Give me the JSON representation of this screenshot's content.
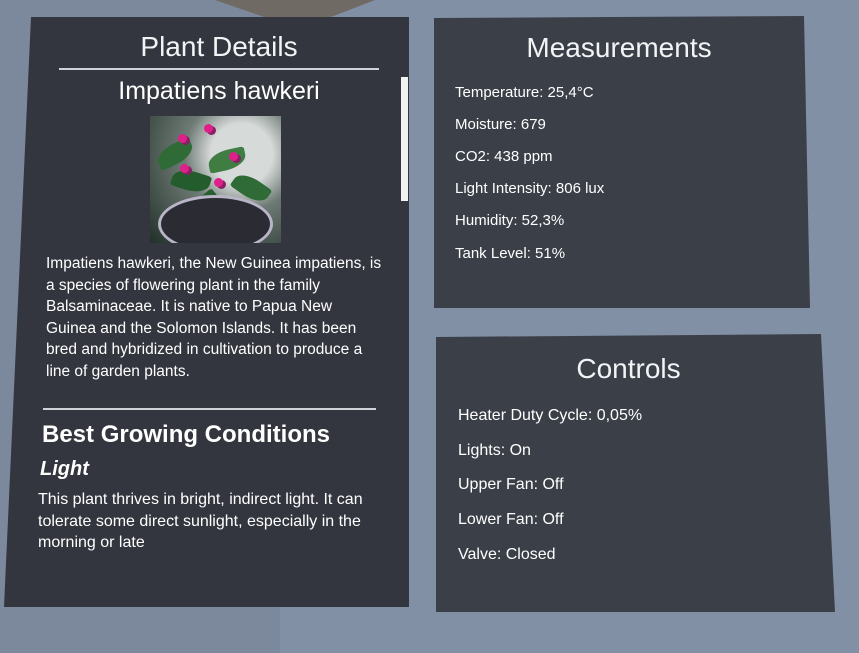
{
  "details": {
    "title": "Plant Details",
    "plant_name": "Impatiens hawkeri",
    "image_subject": "potted-impatiens-photo",
    "description": "Impatiens hawkeri, the New Guinea impatiens, is a species of flowering plant in the family Balsaminaceae. It is native to Papua New Guinea and the Solomon Islands. It has been bred and hybridized in cultivation to produce a line of garden plants.",
    "section_heading": "Best Growing Conditions",
    "light_heading": "Light",
    "light_text": "This plant thrives in bright, indirect light. It can tolerate some direct sunlight, especially in the morning or late"
  },
  "measurements": {
    "title": "Measurements",
    "items": [
      "Temperature: 25,4°C",
      "Moisture: 679",
      "CO2: 438 ppm",
      "Light Intensity: 806 lux",
      "Humidity: 52,3%",
      "Tank Level: 51%"
    ]
  },
  "controls": {
    "title": "Controls",
    "items": [
      "Heater Duty Cycle: 0,05%",
      "Lights: On",
      "Upper Fan: Off",
      "Lower Fan: Off",
      "Valve: Closed"
    ]
  },
  "colors": {
    "background": "#7f8ca0",
    "panel": "#33363e",
    "text": "#ffffff"
  }
}
